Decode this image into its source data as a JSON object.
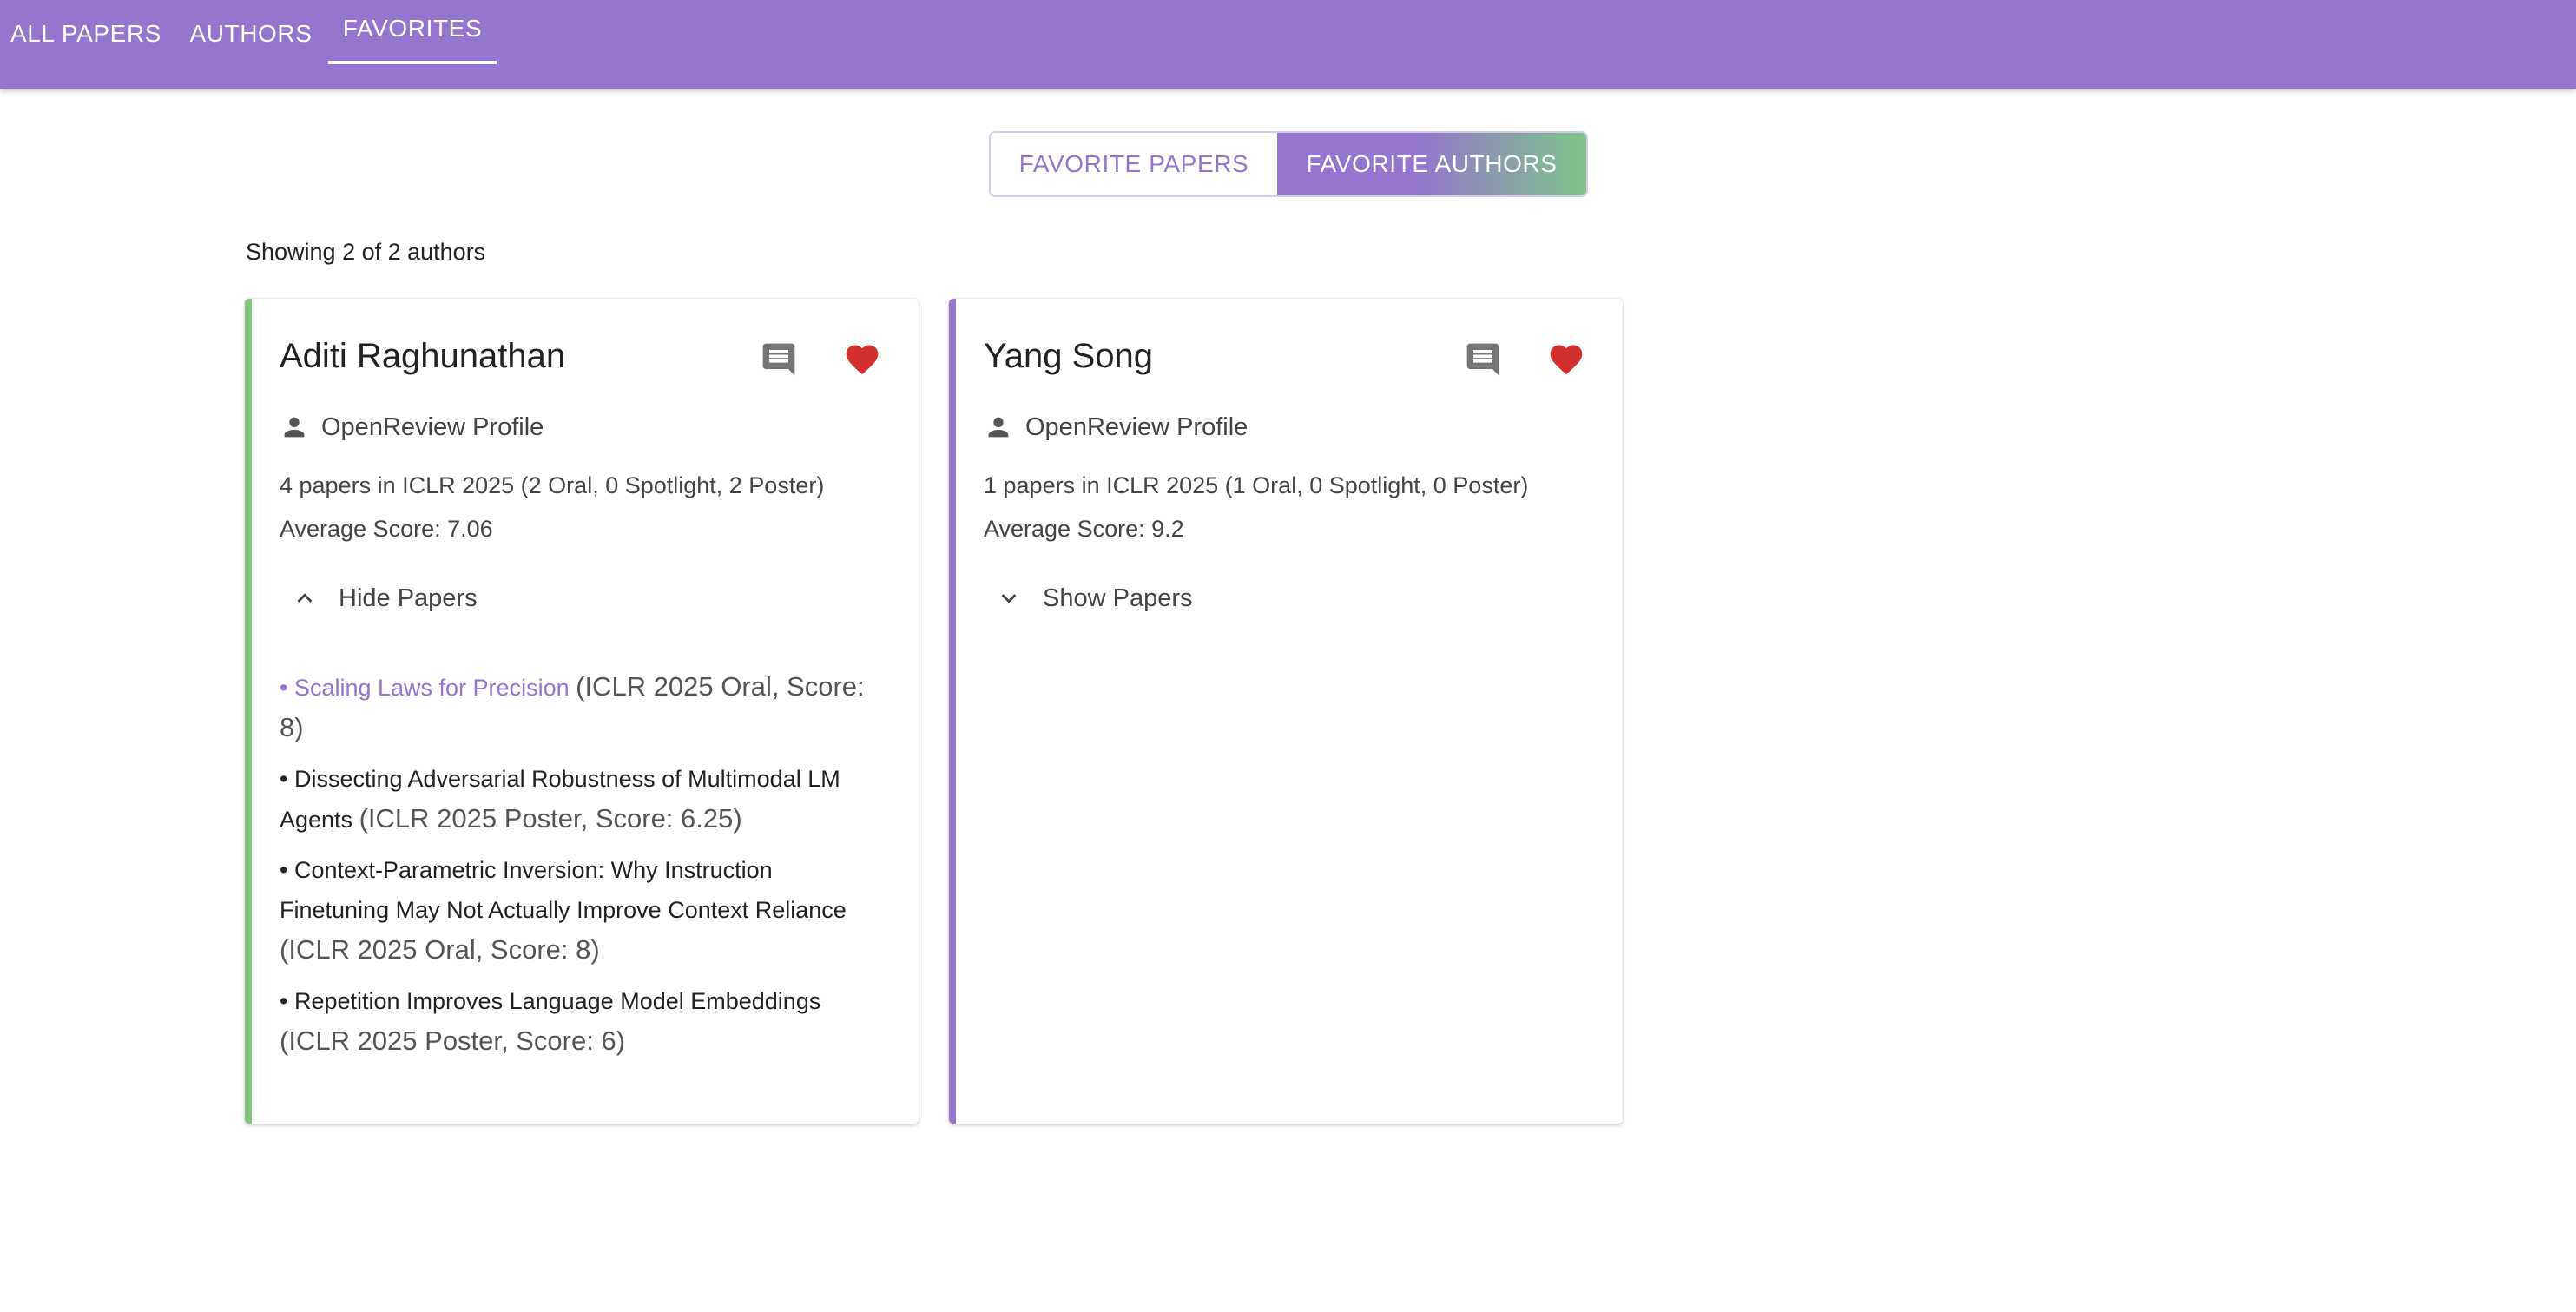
{
  "nav": {
    "tabs": [
      {
        "label": "ALL PAPERS"
      },
      {
        "label": "AUTHORS"
      },
      {
        "label": "FAVORITES"
      }
    ],
    "active": "FAVORITES"
  },
  "toggle": {
    "favorite_papers": "FAVORITE PAPERS",
    "favorite_authors": "FAVORITE AUTHORS",
    "selected": "FAVORITE AUTHORS"
  },
  "summary": "Showing 2 of 2 authors",
  "colors": {
    "primary": "#9575cd",
    "accent_green": "#7fc47f",
    "heart": "#d32f2f"
  },
  "authors": [
    {
      "name": "Aditi Raghunathan",
      "profile_label": "OpenReview Profile",
      "papers_summary": "4 papers in ICLR 2025 (2 Oral, 0 Spotlight, 2 Poster)",
      "average_score": "Average Score: 7.06",
      "papers_toggle": "Hide Papers",
      "papers_toggle_icon": "chevron-up-icon",
      "papers": [
        {
          "title": "• Scaling Laws for Precision",
          "meta": "(ICLR 2025 Oral, Score: 8)"
        },
        {
          "title": "• Dissecting Adversarial Robustness of Multimodal LM Agents",
          "meta": "(ICLR 2025 Poster, Score: 6.25)"
        },
        {
          "title": "• Context-Parametric Inversion: Why Instruction Finetuning May Not Actually Improve Context Reliance",
          "meta": "(ICLR 2025 Oral, Score: 8)"
        },
        {
          "title": "• Repetition Improves Language Model Embeddings",
          "meta": "(ICLR 2025 Poster, Score: 6)"
        }
      ]
    },
    {
      "name": "Yang Song",
      "profile_label": "OpenReview Profile",
      "papers_summary": "1 papers in ICLR 2025 (1 Oral, 0 Spotlight, 0 Poster)",
      "average_score": "Average Score: 9.2",
      "papers_toggle": "Show Papers",
      "papers_toggle_icon": "chevron-down-icon"
    }
  ]
}
